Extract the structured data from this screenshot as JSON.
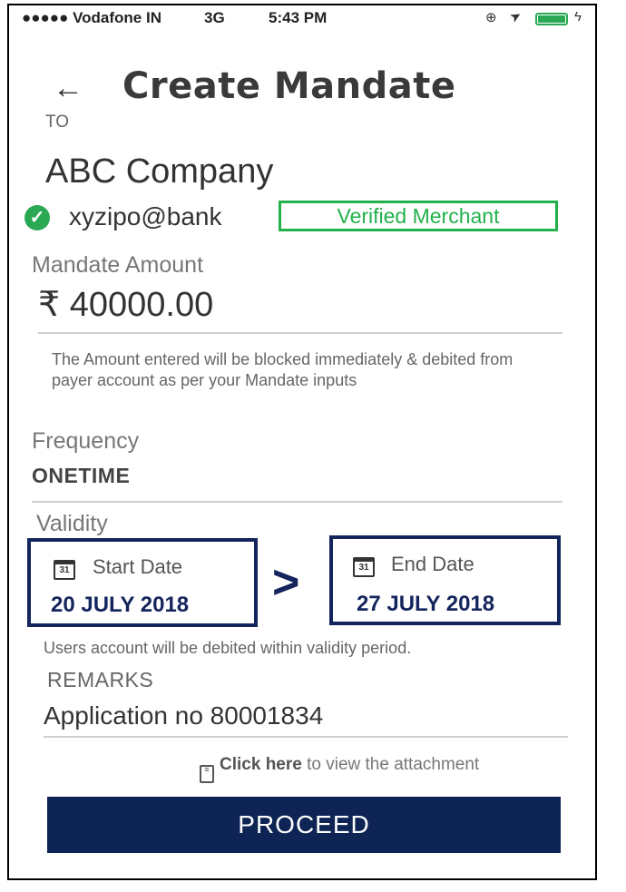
{
  "status_bar": {
    "carrier": "●●●●● Vodafone IN",
    "network": "3G",
    "time": "5:43 PM",
    "icons": [
      "lock-rotation-icon",
      "location-arrow-icon",
      "battery-icon",
      "charging-icon"
    ]
  },
  "header": {
    "back_icon": "←",
    "title": "Create Mandate"
  },
  "payee": {
    "to_label": "TO",
    "name": "ABC Company",
    "vpa": "xyzipo@bank",
    "verified_badge": "Verified Merchant"
  },
  "amount": {
    "label": "Mandate Amount",
    "currency_symbol": "₹",
    "value": "40000.00",
    "note": "The Amount entered will be blocked immediately & debited from payer account as per your Mandate inputs"
  },
  "frequency": {
    "label": "Frequency",
    "value": "ONETIME"
  },
  "validity": {
    "label": "Validity",
    "start_label": "Start Date",
    "start_value": "20 JULY 2018",
    "separator": ">",
    "end_label": "End Date",
    "end_value": "27 JULY 2018",
    "calendar_day": "31",
    "note": "Users account will be debited within validity period."
  },
  "remarks": {
    "label": "REMARKS",
    "value": "Application no 80001834"
  },
  "attachment": {
    "link_text": "Click here",
    "rest_text": " to view the attachment"
  },
  "proceed_button": "PROCEED",
  "colors": {
    "primary": "#0d2454",
    "verified_green": "#22b14c"
  }
}
